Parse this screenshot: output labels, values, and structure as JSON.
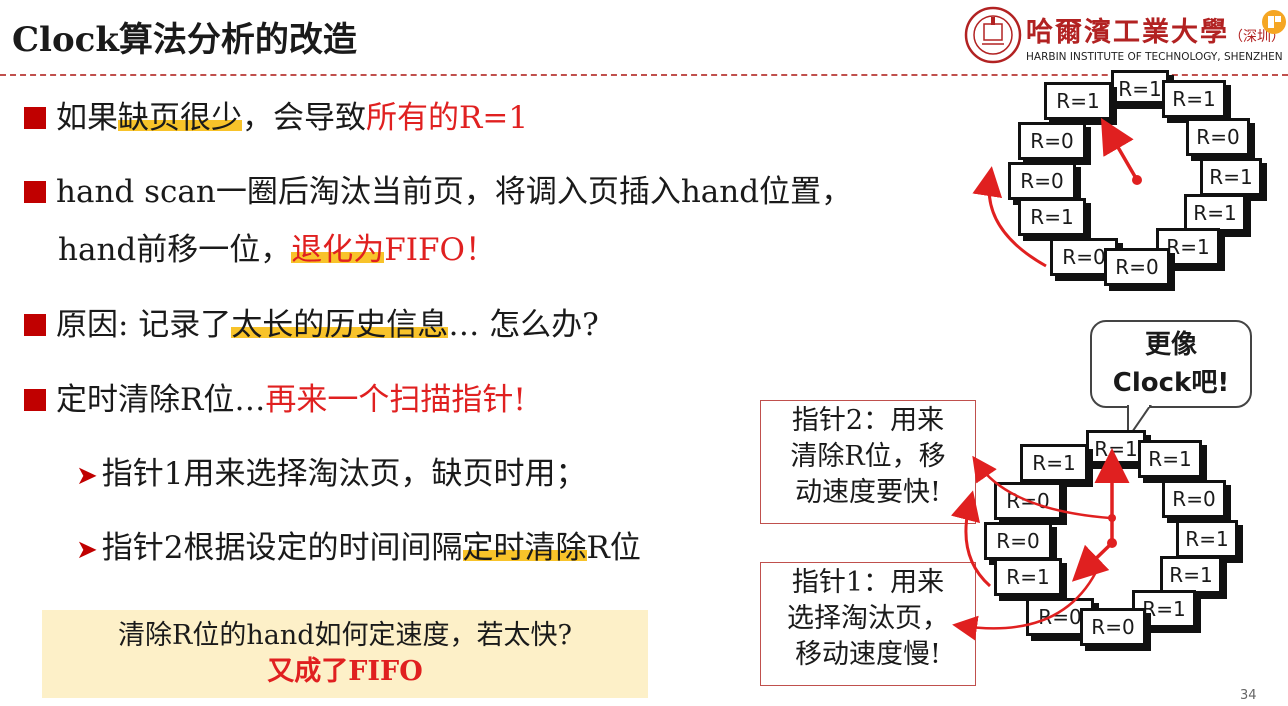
{
  "title": "Clock算法分析的改造",
  "logo": {
    "cn": "哈爾濱工業大學",
    "cn_suffix": "（深圳）",
    "en": "HARBIN INSTITUTE OF TECHNOLOGY, SHENZHEN"
  },
  "bullets": {
    "b1": {
      "p1": "如果",
      "p2": "缺页很少",
      "p3": "，会导致",
      "p4": "所有的R=1"
    },
    "b2": {
      "line1": "hand scan一圈后淘汰当前页，将调入页插入hand位置，",
      "p1": "hand前移一位，",
      "p2": "退化为",
      "p3": "FIFO！"
    },
    "b3": {
      "p1": "原因: 记录了",
      "p2": "太长的历史信息",
      "p3": "… 怎么办?"
    },
    "b4": {
      "p1": "定时清除R位…",
      "p2": "再来一个扫描指针!"
    },
    "s1": {
      "text": "指针1用来选择淘汰页，缺页时用；"
    },
    "s2": {
      "p1": "指针2根据设定的时间间隔",
      "p2": "定时清除",
      "p3": "R位"
    }
  },
  "note": {
    "line1": "清除R位的hand如何定速度，若太快?",
    "line2": "又成了FIFO"
  },
  "callout": {
    "line1": "更像",
    "line2": "Clock吧!"
  },
  "box_hand2": {
    "line1": "指针2：用来",
    "line2": "清除R位，移",
    "line3": "动速度要快!"
  },
  "box_hand1": {
    "line1": "指针1：用来",
    "line2": "选择淘汰页，",
    "line3": "移动速度慢!"
  },
  "clock_top": [
    "R=1",
    "R=1",
    "R=1",
    "R=0",
    "R=1",
    "R=1",
    "R=1",
    "R=0",
    "R=0",
    "R=1",
    "R=0",
    "R=0"
  ],
  "clock_bottom": [
    "R=1",
    "R=1",
    "R=1",
    "R=0",
    "R=1",
    "R=1",
    "R=1",
    "R=0",
    "R=0",
    "R=1",
    "R=0",
    "R=0"
  ],
  "page_number": "34",
  "colors": {
    "accent_red": "#c00000",
    "text_red": "#e02020",
    "highlight": "#f8c32a",
    "note_bg": "#fdf0c8",
    "logo_red": "#b22222"
  }
}
